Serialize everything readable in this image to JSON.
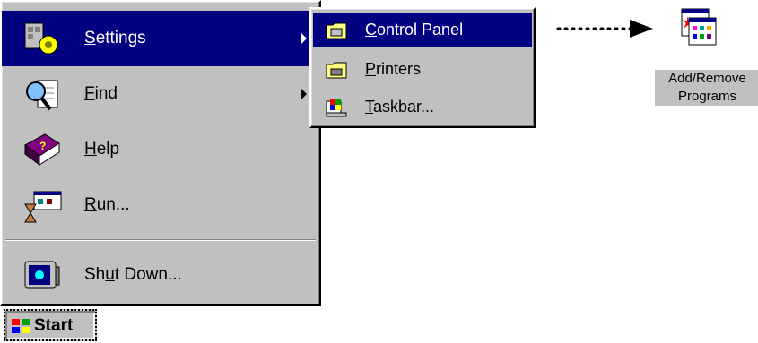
{
  "start_menu": {
    "items": [
      {
        "name": "settings",
        "pre": "",
        "ul": "S",
        "post": "ettings",
        "has_submenu": true,
        "highlighted": true
      },
      {
        "name": "find",
        "pre": "",
        "ul": "F",
        "post": "ind",
        "has_submenu": true,
        "highlighted": false
      },
      {
        "name": "help",
        "pre": "",
        "ul": "H",
        "post": "elp",
        "has_submenu": false,
        "highlighted": false
      },
      {
        "name": "run",
        "pre": "",
        "ul": "R",
        "post": "un...",
        "has_submenu": false,
        "highlighted": false
      },
      {
        "name": "shut-down",
        "pre": "Sh",
        "ul": "u",
        "post": "t Down...",
        "has_submenu": false,
        "highlighted": false
      }
    ]
  },
  "settings_submenu": {
    "items": [
      {
        "name": "control-panel",
        "pre": "",
        "ul": "C",
        "post": "ontrol Panel",
        "highlighted": true
      },
      {
        "name": "printers",
        "pre": "",
        "ul": "P",
        "post": "rinters",
        "highlighted": false
      },
      {
        "name": "taskbar",
        "pre": "",
        "ul": "T",
        "post": "askbar...",
        "highlighted": false
      }
    ]
  },
  "start_button": {
    "label": "Start"
  },
  "desktop_icon": {
    "line1": "Add/Remove",
    "line2": "Programs"
  },
  "colors": {
    "highlight": "#000080",
    "menu_bg": "#c0c0c0",
    "highlight_text": "#ffffff"
  }
}
